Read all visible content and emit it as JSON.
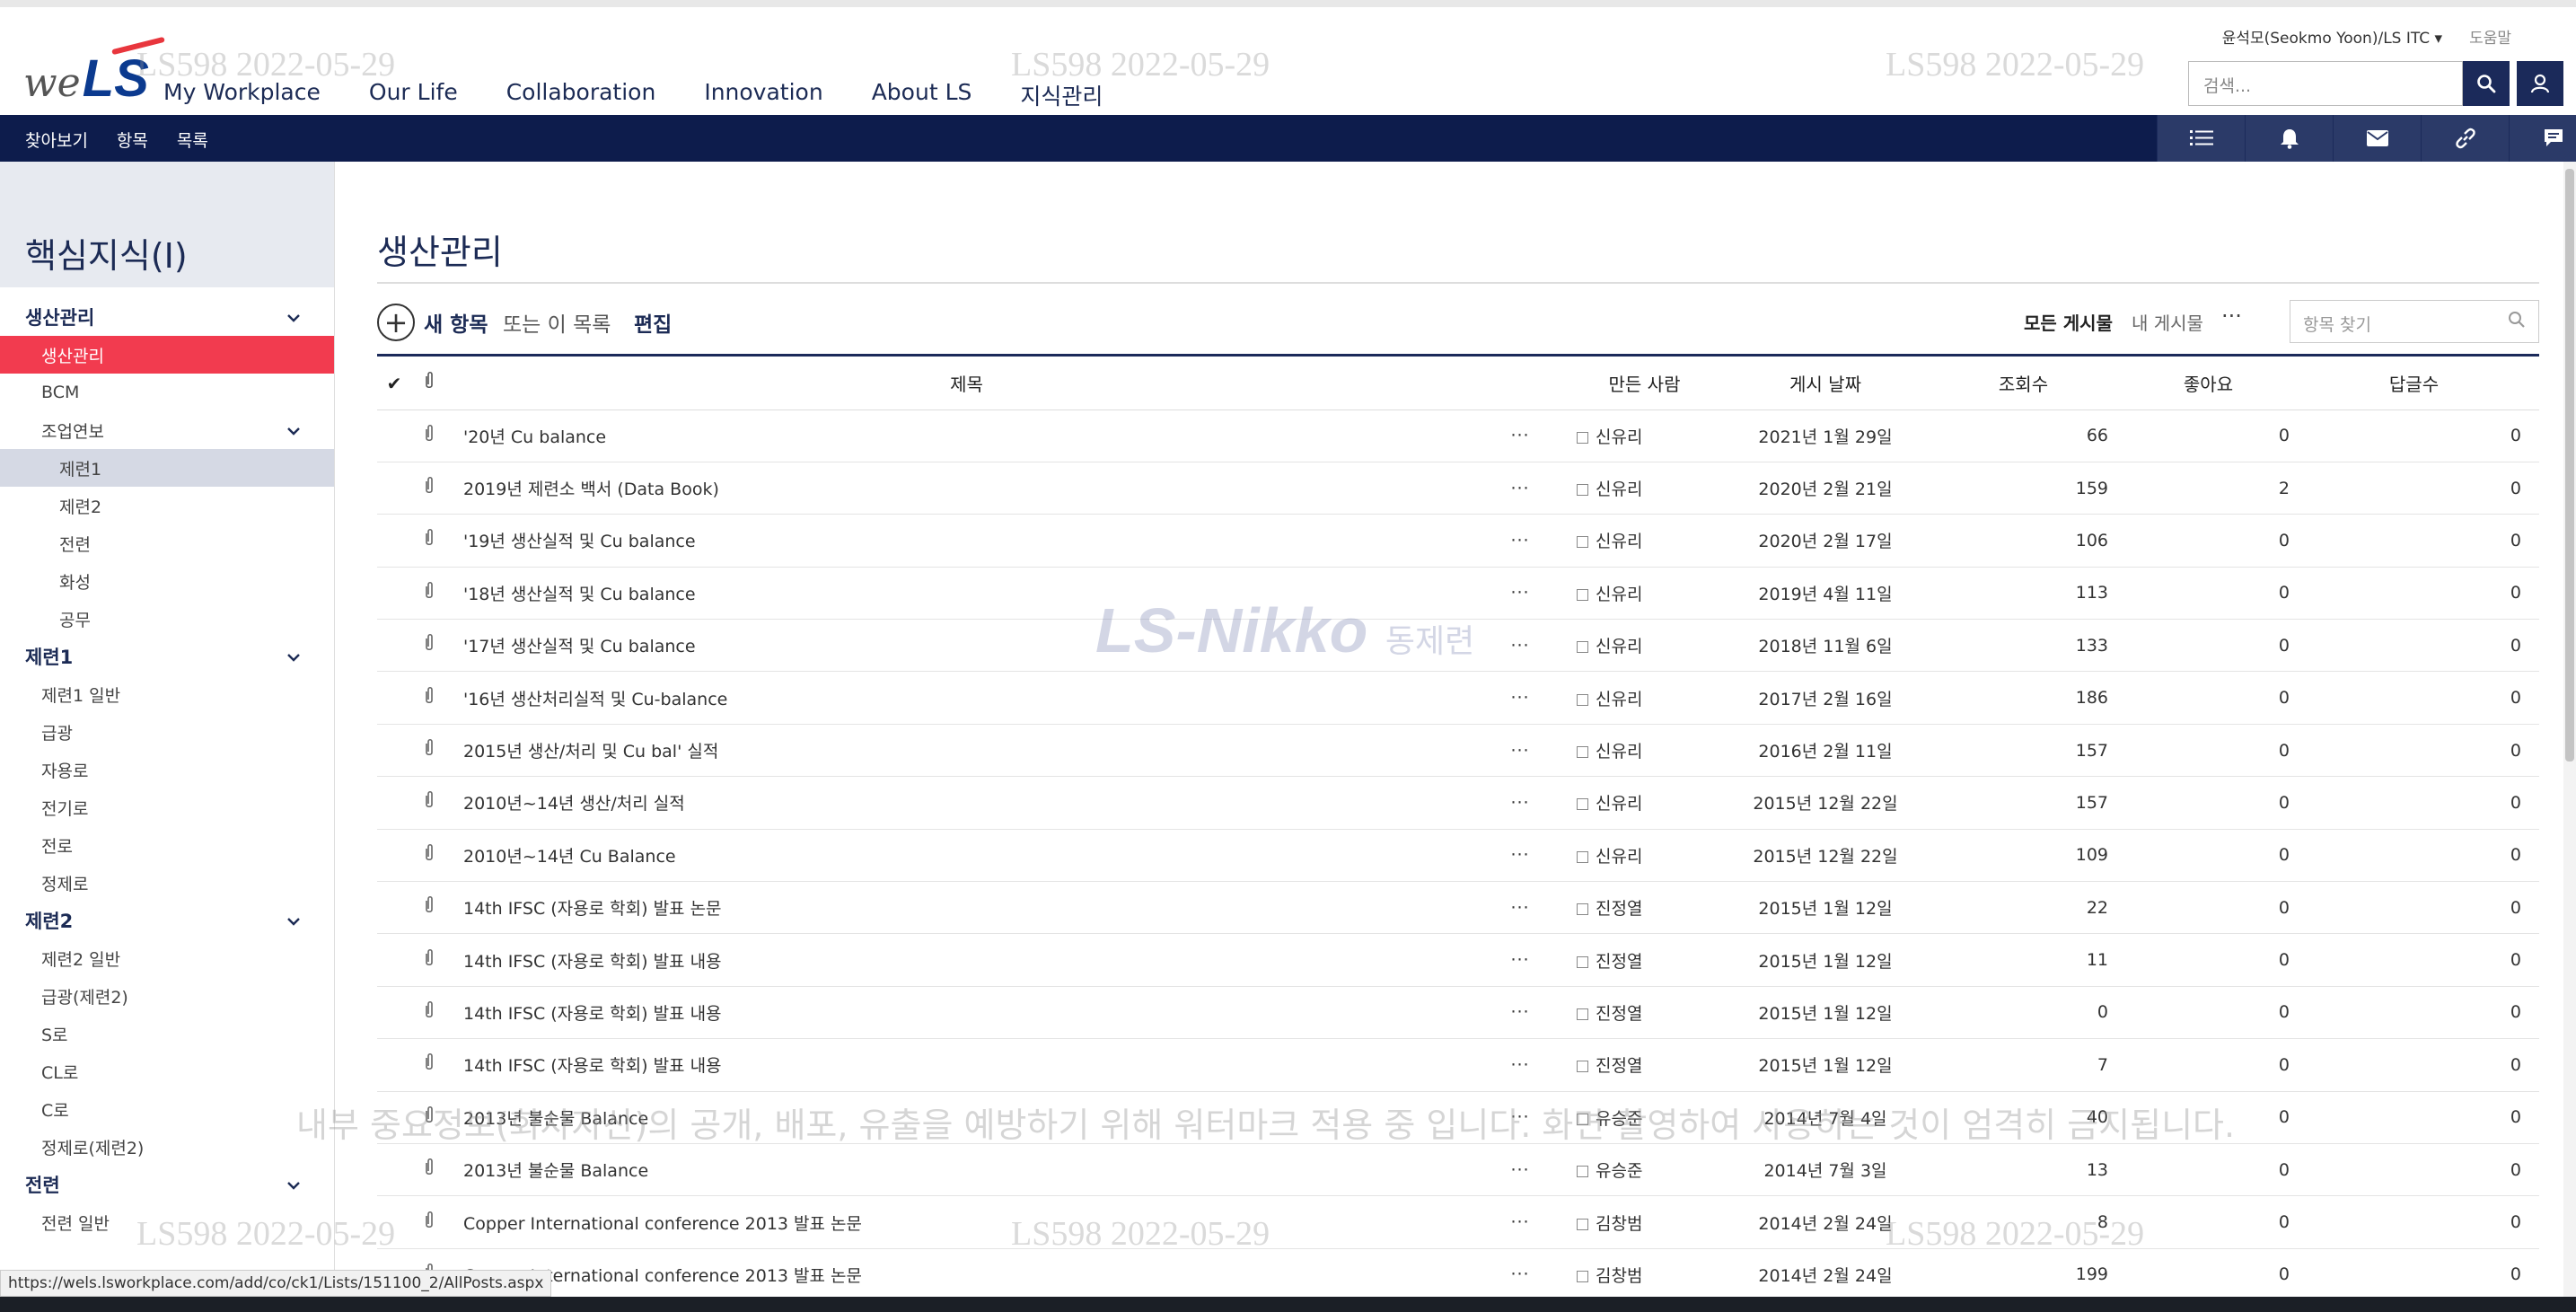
{
  "header": {
    "logo_we": "we",
    "logo_ls": "LS",
    "nav": [
      "My Workplace",
      "Our Life",
      "Collaboration",
      "Innovation",
      "About LS",
      "지식관리"
    ],
    "user": "윤석모(Seokmo Yoon)/LS ITC ▾",
    "help": "도움말",
    "search_placeholder": "검색..."
  },
  "watermark": {
    "stamp": "LS598 2022-05-29",
    "notice": "내부 중요정보(회사자산)의 공개, 배포, 유출을 예방하기 위해 워터마크 적용 중 입니다. 화면 촬영하여 사용하는 것이 엄격히 금지됩니다.",
    "logo_main": "LS-Nikko",
    "logo_sub": "동제련"
  },
  "navbar": {
    "links": [
      "찾아보기",
      "항목",
      "목록"
    ],
    "icons": [
      "list-icon",
      "bell-icon",
      "mail-icon",
      "link-icon",
      "chat-icon"
    ]
  },
  "sidebar": {
    "title": "핵심지식(Ⅰ)",
    "items": [
      {
        "label": "생산관리",
        "type": "group",
        "chevron": true
      },
      {
        "label": "생산관리",
        "type": "lvl1",
        "state": "active"
      },
      {
        "label": "BCM",
        "type": "lvl1"
      },
      {
        "label": "조업연보",
        "type": "lvl1",
        "chevron": true
      },
      {
        "label": "제련1",
        "type": "lvl2",
        "state": "sel"
      },
      {
        "label": "제련2",
        "type": "lvl2"
      },
      {
        "label": "전련",
        "type": "lvl2"
      },
      {
        "label": "화성",
        "type": "lvl2"
      },
      {
        "label": "공무",
        "type": "lvl2"
      },
      {
        "label": "제련1",
        "type": "group",
        "chevron": true
      },
      {
        "label": "제련1 일반",
        "type": "lvl1"
      },
      {
        "label": "급광",
        "type": "lvl1"
      },
      {
        "label": "자용로",
        "type": "lvl1"
      },
      {
        "label": "전기로",
        "type": "lvl1"
      },
      {
        "label": "전로",
        "type": "lvl1"
      },
      {
        "label": "정제로",
        "type": "lvl1"
      },
      {
        "label": "제련2",
        "type": "group",
        "chevron": true
      },
      {
        "label": "제련2 일반",
        "type": "lvl1"
      },
      {
        "label": "급광(제련2)",
        "type": "lvl1"
      },
      {
        "label": "S로",
        "type": "lvl1"
      },
      {
        "label": "CL로",
        "type": "lvl1"
      },
      {
        "label": "C로",
        "type": "lvl1"
      },
      {
        "label": "정제로(제련2)",
        "type": "lvl1"
      },
      {
        "label": "전련",
        "type": "group",
        "chevron": true
      },
      {
        "label": "전련 일반",
        "type": "lvl1"
      }
    ]
  },
  "main": {
    "page_title": "생산관리",
    "toolbar": {
      "plus": "+",
      "new_item": "새 항목",
      "or_text": "또는 이 목록",
      "edit": "편집",
      "view_all": "모든 게시물",
      "view_mine": "내 게시물",
      "more": "···",
      "find_placeholder": "항목 찾기"
    },
    "columns": {
      "check": "✔",
      "title": "제목",
      "author": "만든 사람",
      "date": "게시 날짜",
      "views": "조회수",
      "likes": "좋아요",
      "replies": "답글수"
    },
    "rows": [
      {
        "title": "'20년 Cu balance",
        "author": "신유리",
        "date": "2021년 1월 29일",
        "views": "66",
        "likes": "0",
        "replies": "0"
      },
      {
        "title": "2019년 제련소 백서 (Data Book)",
        "author": "신유리",
        "date": "2020년 2월 21일",
        "views": "159",
        "likes": "2",
        "replies": "0"
      },
      {
        "title": "'19년 생산실적 및 Cu balance",
        "author": "신유리",
        "date": "2020년 2월 17일",
        "views": "106",
        "likes": "0",
        "replies": "0"
      },
      {
        "title": "'18년 생산실적 및 Cu balance",
        "author": "신유리",
        "date": "2019년 4월 11일",
        "views": "113",
        "likes": "0",
        "replies": "0"
      },
      {
        "title": "'17년 생산실적 및 Cu balance",
        "author": "신유리",
        "date": "2018년 11월 6일",
        "views": "133",
        "likes": "0",
        "replies": "0"
      },
      {
        "title": "'16년 생산처리실적 및 Cu-balance",
        "author": "신유리",
        "date": "2017년 2월 16일",
        "views": "186",
        "likes": "0",
        "replies": "0"
      },
      {
        "title": "2015년 생산/처리 및 Cu bal' 실적",
        "author": "신유리",
        "date": "2016년 2월 11일",
        "views": "157",
        "likes": "0",
        "replies": "0"
      },
      {
        "title": "2010년~14년 생산/처리 실적",
        "author": "신유리",
        "date": "2015년 12월 22일",
        "views": "157",
        "likes": "0",
        "replies": "0"
      },
      {
        "title": "2010년~14년 Cu Balance",
        "author": "신유리",
        "date": "2015년 12월 22일",
        "views": "109",
        "likes": "0",
        "replies": "0"
      },
      {
        "title": "14th IFSC (자용로 학회) 발표 논문",
        "author": "진정열",
        "date": "2015년 1월 12일",
        "views": "22",
        "likes": "0",
        "replies": "0"
      },
      {
        "title": "14th IFSC (자용로 학회) 발표 내용",
        "author": "진정열",
        "date": "2015년 1월 12일",
        "views": "11",
        "likes": "0",
        "replies": "0"
      },
      {
        "title": "14th IFSC (자용로 학회) 발표 내용",
        "author": "진정열",
        "date": "2015년 1월 12일",
        "views": "0",
        "likes": "0",
        "replies": "0"
      },
      {
        "title": "14th IFSC (자용로 학회) 발표 내용",
        "author": "진정열",
        "date": "2015년 1월 12일",
        "views": "7",
        "likes": "0",
        "replies": "0"
      },
      {
        "title": "2013년 불순물 Balance",
        "author": "유승준",
        "date": "2014년 7월 4일",
        "views": "40",
        "likes": "0",
        "replies": "0"
      },
      {
        "title": "2013년 불순물 Balance",
        "author": "유승준",
        "date": "2014년 7월 3일",
        "views": "13",
        "likes": "0",
        "replies": "0"
      },
      {
        "title": "Copper International conference 2013 발표 논문",
        "author": "김창범",
        "date": "2014년 2월 24일",
        "views": "8",
        "likes": "0",
        "replies": "0"
      },
      {
        "title": "Copper International conference 2013 발표 논문",
        "author": "김창범",
        "date": "2014년 2월 24일",
        "views": "199",
        "likes": "0",
        "replies": "0"
      }
    ]
  },
  "status": {
    "url": "https://wels.lsworkplace.com/add/co/ck1/Lists/151100_2/AllPosts.aspx"
  },
  "colors": {
    "navy": "#0d1c4c",
    "active": "#f23b4f",
    "selected": "#d5d9e4"
  }
}
